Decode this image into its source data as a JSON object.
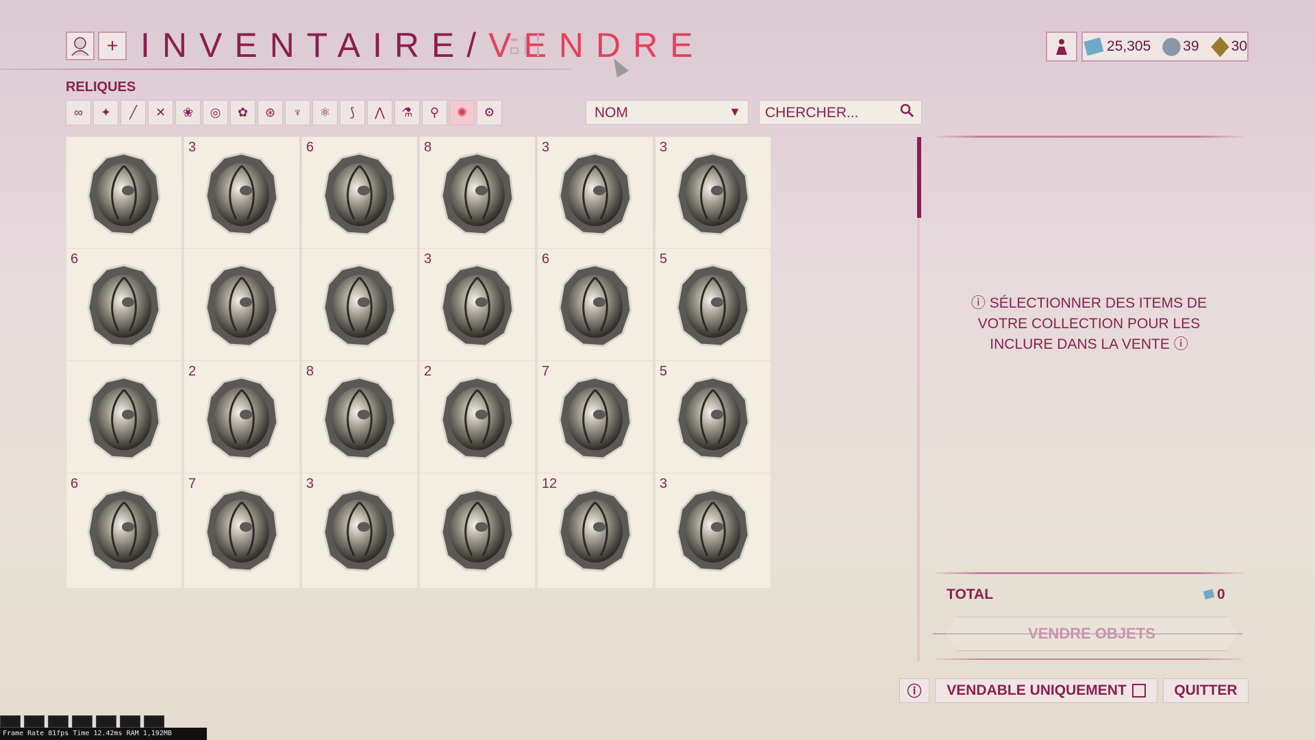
{
  "header": {
    "title_part1": "INVENTAIRE/",
    "title_part2": "VENDRE",
    "add_button": "+",
    "currency": {
      "credits": "25,305",
      "endo": "39",
      "platinum": "30"
    }
  },
  "category": {
    "label": "RELIQUES"
  },
  "filters": [
    {
      "icon": "infinity-icon",
      "glyph": "∞"
    },
    {
      "icon": "warframe-icon",
      "glyph": "✦"
    },
    {
      "icon": "primary-weapon-icon",
      "glyph": "╱"
    },
    {
      "icon": "secondary-weapon-icon",
      "glyph": "✕"
    },
    {
      "icon": "melee-icon",
      "glyph": "❀"
    },
    {
      "icon": "companion-icon",
      "glyph": "◎"
    },
    {
      "icon": "sentinel-icon",
      "glyph": "✿"
    },
    {
      "icon": "archwing-icon",
      "glyph": "⊛"
    },
    {
      "icon": "mod-icon",
      "glyph": "♆"
    },
    {
      "icon": "resource-icon",
      "glyph": "⚛"
    },
    {
      "icon": "fish-icon",
      "glyph": "⟆"
    },
    {
      "icon": "gear-icon",
      "glyph": "⋀"
    },
    {
      "icon": "arcane-icon",
      "glyph": "⚗"
    },
    {
      "icon": "key-icon",
      "glyph": "⚲"
    },
    {
      "icon": "relic-icon",
      "glyph": "✺",
      "active": true
    },
    {
      "icon": "misc-icon",
      "glyph": "⚙"
    }
  ],
  "sort": {
    "value": "NOM"
  },
  "search": {
    "placeholder": "CHERCHER..."
  },
  "relics": [
    {
      "count": ""
    },
    {
      "count": "3"
    },
    {
      "count": "6"
    },
    {
      "count": "8"
    },
    {
      "count": "3"
    },
    {
      "count": "3"
    },
    {
      "count": "6"
    },
    {
      "count": ""
    },
    {
      "count": ""
    },
    {
      "count": "3"
    },
    {
      "count": "6"
    },
    {
      "count": "5"
    },
    {
      "count": ""
    },
    {
      "count": "2"
    },
    {
      "count": "8"
    },
    {
      "count": "2"
    },
    {
      "count": "7"
    },
    {
      "count": "5"
    },
    {
      "count": "6"
    },
    {
      "count": "7"
    },
    {
      "count": "3"
    },
    {
      "count": ""
    },
    {
      "count": "12"
    },
    {
      "count": "3"
    }
  ],
  "panel": {
    "message_line1": "SÉLECTIONNER DES ITEMS DE",
    "message_line2": "VOTRE COLLECTION POUR LES",
    "message_line3": "INCLURE DANS LA VENTE",
    "total_label": "TOTAL",
    "total_value": "0",
    "sell_button": "VENDRE OBJETS"
  },
  "footer": {
    "sellable_only": "VENDABLE UNIQUEMENT",
    "quit": "QUITTER"
  },
  "debug": {
    "stats": "Frame Rate 81fps Time 12.42ms RAM 1,192MB"
  },
  "colors": {
    "accent": "#8a1f4e",
    "highlight": "#e3405c",
    "card_bg": "#f3eee1"
  }
}
